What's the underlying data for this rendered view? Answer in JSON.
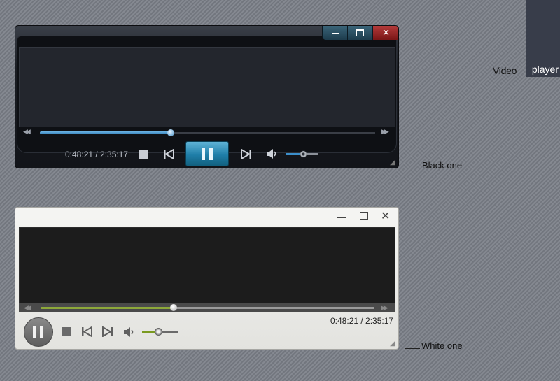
{
  "header": {
    "word1": "Video",
    "word2": "player"
  },
  "captions": {
    "black": "Black one",
    "white": "White one"
  },
  "black_player": {
    "window_buttons": {
      "minimize_icon": "minimize-icon",
      "maximize_icon": "maximize-icon",
      "close_icon": "close-icon"
    },
    "time": "0:48:21 / 2:35:17",
    "seek_progress": 0.39,
    "volume_level": 0.5,
    "accent_color": "#2f7cb5"
  },
  "white_player": {
    "window_buttons": {
      "minimize_icon": "minimize-icon",
      "maximize_icon": "maximize-icon",
      "close_icon": "close-icon"
    },
    "time": "0:48:21 / 2:35:17",
    "seek_progress": 0.4,
    "volume_level": 0.42,
    "accent_color": "#8da83a"
  }
}
